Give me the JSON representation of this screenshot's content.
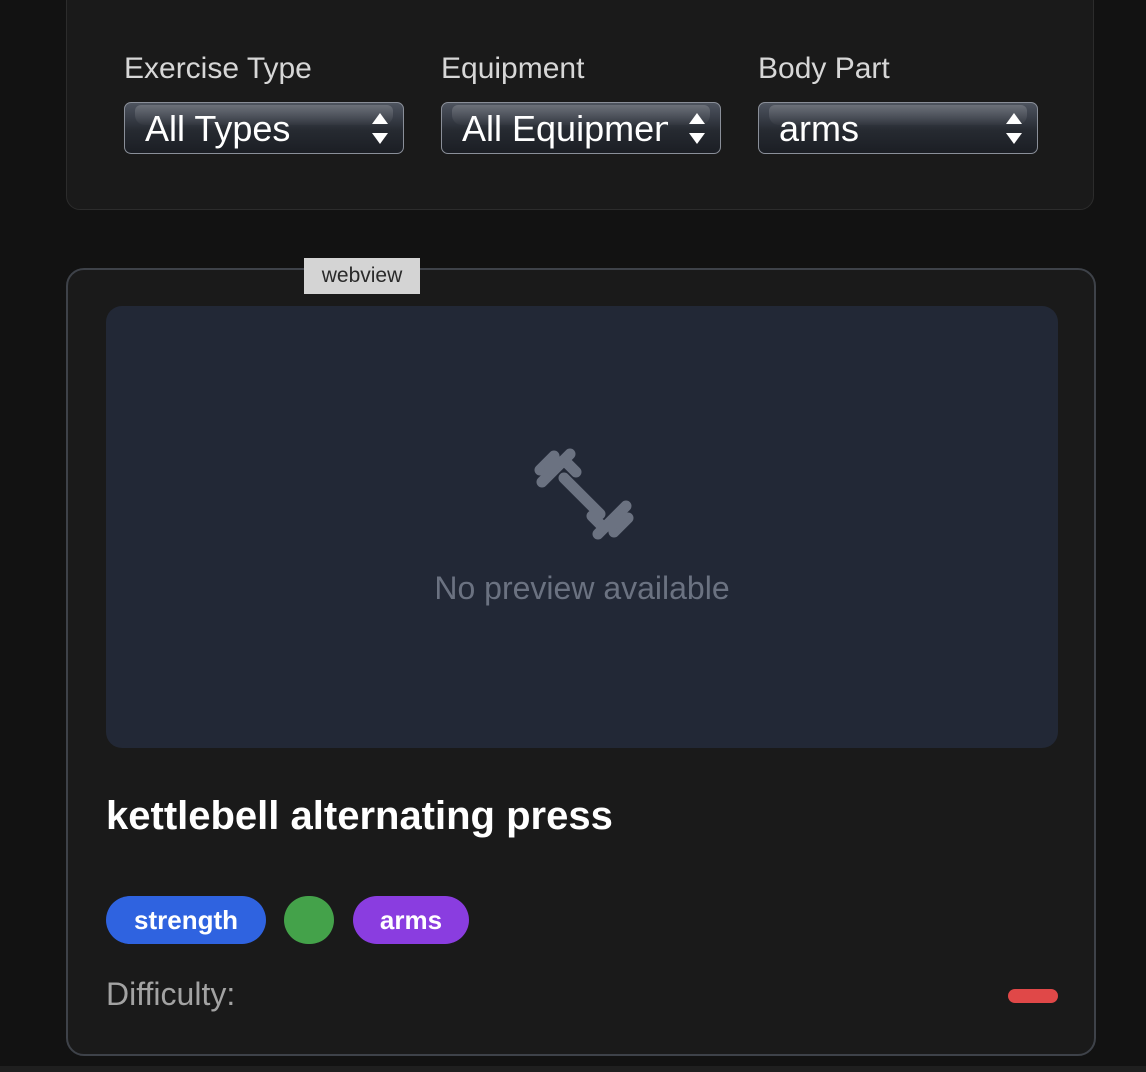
{
  "filters": {
    "exercise_type": {
      "label": "Exercise Type",
      "value": "All Types"
    },
    "equipment": {
      "label": "Equipment",
      "value": "All Equipment"
    },
    "body_part": {
      "label": "Body Part",
      "value": "arms"
    }
  },
  "webview_tag": "webview",
  "card": {
    "preview_text": "No preview available",
    "preview_icon": "dumbbell-icon",
    "title": "kettlebell alternating press",
    "tags": {
      "type": "strength",
      "equipment": "",
      "body_part": "arms"
    },
    "difficulty_label": "Difficulty:",
    "colors": {
      "type_tag": "#2f63e0",
      "equipment_tag": "#44a24a",
      "body_part_tag": "#8a3de0",
      "difficulty": "#e04848"
    }
  }
}
